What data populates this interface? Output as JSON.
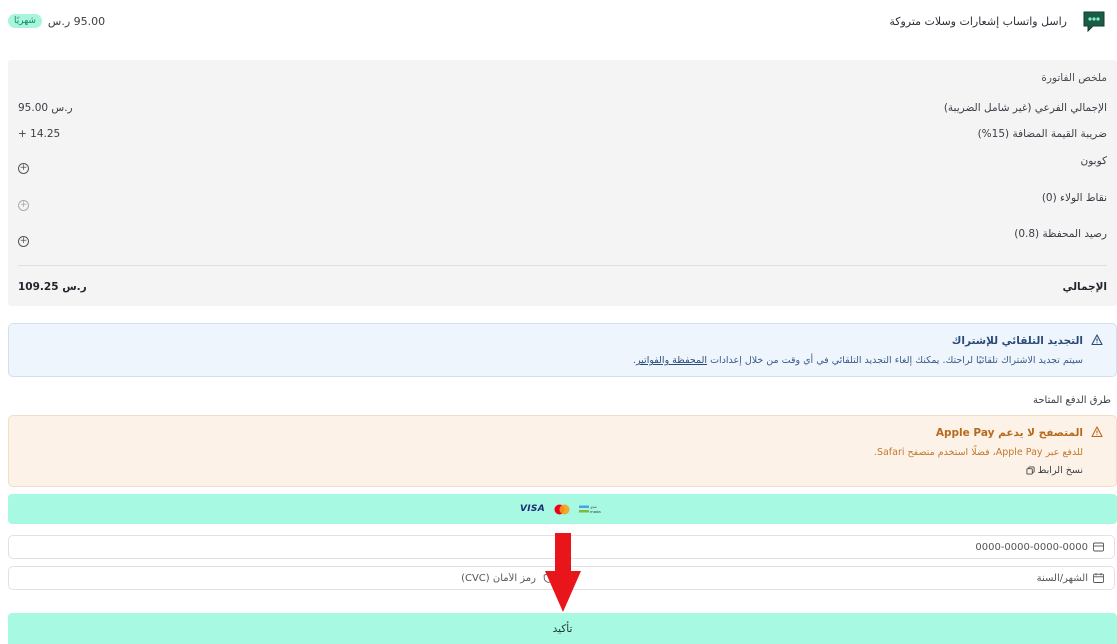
{
  "header": {
    "product_title": "راسل واتساب إشعارات وسلات متروكة",
    "period_badge": "شهريًا",
    "price": "95.00 ر.س",
    "logo_icon": "chat-bubble-icon"
  },
  "summary": {
    "title": "ملخص الفاتورة",
    "subtotal_label": "الإجمالي الفرعي (غير شامل الضريبة)",
    "subtotal_value": "95.00 ر.س",
    "vat_label": "ضريبة القيمة المضافة (15%)",
    "vat_value": "+ 14.25",
    "coupon_label": "كوبون",
    "loyalty_label": "نقاط الولاء (0)",
    "wallet_label": "رصيد المحفظة (0.8)",
    "total_label": "الإجمالي",
    "total_value": "109.25 ر.س"
  },
  "info_alert": {
    "title": "التجديد التلقائي للإشتراك",
    "text": "سيتم تجديد الاشتراك تلقائيًا لراحتك. يمكنك إلغاء التجديد التلقائي في أي وقت من خلال إعدادات",
    "link_text": "المحفظة والفواتير",
    "text_end": "."
  },
  "payment_methods_heading": "طرق الدفع المتاحة",
  "warning_alert": {
    "title": "المتصفح لا يدعم Apple Pay",
    "text": "للدفع عبر Apple Pay، فضلًا استخدم متصفح Safari.",
    "copy_link": "نسخ الرابط"
  },
  "card_brands": {
    "visa": "VISA",
    "mastercard": "mastercard-icon",
    "mada": "mada-icon"
  },
  "form": {
    "card_number_placeholder": "0000-0000-0000-0000",
    "expiry_placeholder": "الشهر/السنة",
    "cvc_placeholder": "رمز الأمان (CVC)"
  },
  "confirm_label": "تأكيد",
  "colors": {
    "accent": "#a8f9e1",
    "info_bg": "#eef5fd",
    "warn_bg": "#fdf2e8",
    "annotation_arrow": "#e8151b"
  }
}
